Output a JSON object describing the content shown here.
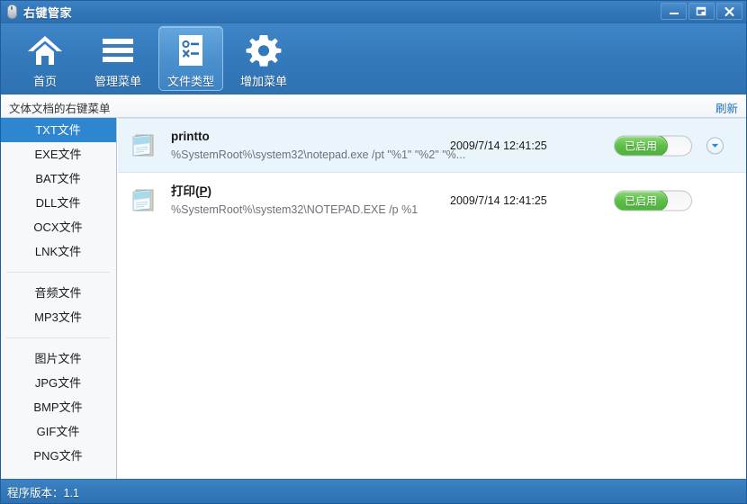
{
  "window": {
    "title": "右键管家",
    "icon": "mouse-icon",
    "controls": [
      {
        "name": "minimize",
        "glyph": "minimize-icon"
      },
      {
        "name": "restore",
        "glyph": "restore-icon"
      },
      {
        "name": "close",
        "glyph": "close-icon"
      }
    ]
  },
  "toolbar": {
    "buttons": [
      {
        "label": "首页",
        "icon": "home-icon",
        "selected": false
      },
      {
        "label": "管理菜单",
        "icon": "list-icon",
        "selected": false
      },
      {
        "label": "文件类型",
        "icon": "file-type-icon",
        "selected": true
      },
      {
        "label": "增加菜单",
        "icon": "gear-icon",
        "selected": false
      }
    ]
  },
  "header": {
    "title": "文体文档的右键菜单",
    "refresh_label": "刷新"
  },
  "sidebar": {
    "groups": [
      {
        "items": [
          {
            "label": "TXT文件",
            "active": true
          },
          {
            "label": "EXE文件",
            "active": false
          },
          {
            "label": "BAT文件",
            "active": false
          },
          {
            "label": "DLL文件",
            "active": false
          },
          {
            "label": "OCX文件",
            "active": false
          },
          {
            "label": "LNK文件",
            "active": false
          }
        ]
      },
      {
        "items": [
          {
            "label": "音频文件",
            "active": false
          },
          {
            "label": "MP3文件",
            "active": false
          }
        ]
      },
      {
        "items": [
          {
            "label": "图片文件",
            "active": false
          },
          {
            "label": "JPG文件",
            "active": false
          },
          {
            "label": "BMP文件",
            "active": false
          },
          {
            "label": "GIF文件",
            "active": false
          },
          {
            "label": "PNG文件",
            "active": false
          }
        ]
      }
    ]
  },
  "list": {
    "rows": [
      {
        "icon": "notepad-icon",
        "name": "printto",
        "name_underline": "",
        "path": "%SystemRoot%\\system32\\notepad.exe /pt \"%1\" \"%2\" \"%...",
        "date": "2009/7/14 12:41:25",
        "toggle_label": "已启用",
        "toggle_on": true,
        "has_dropdown": true,
        "highlighted": true
      },
      {
        "icon": "notepad-icon",
        "name": "打印",
        "name_underline": "P",
        "path": "%SystemRoot%\\system32\\NOTEPAD.EXE /p %1",
        "date": "2009/7/14 12:41:25",
        "toggle_label": "已启用",
        "toggle_on": true,
        "has_dropdown": false,
        "highlighted": false
      }
    ]
  },
  "statusbar": {
    "text": "程序版本：1.1"
  },
  "colors": {
    "title_blue": "#3278b9",
    "selected_tool": "#4a8fcd",
    "sidebar_active": "#2d86cf",
    "toggle_green": "#5ec04a",
    "link_blue": "#1f6fc0",
    "row_highlight": "#eaf4fb"
  }
}
